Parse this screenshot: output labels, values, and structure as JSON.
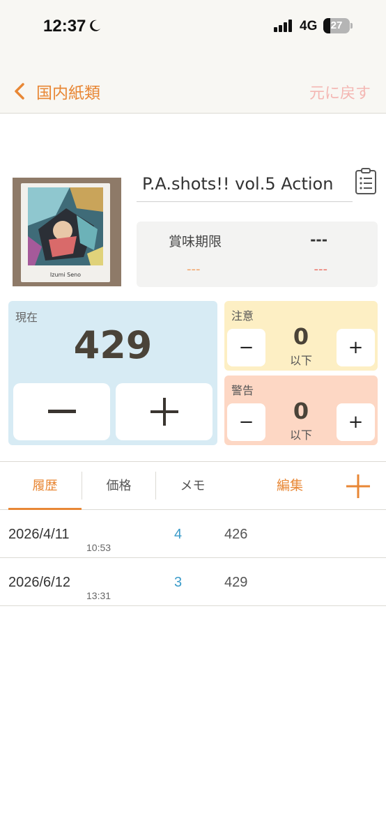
{
  "status_bar": {
    "time": "12:37",
    "network": "4G",
    "battery_percent": "27",
    "battery_level": 0.27
  },
  "nav": {
    "back_label": "国内紙類",
    "revert_label": "元に戻す"
  },
  "item": {
    "thumbnail_caption": "Izumi Seno",
    "title": "P.A.shots!! vol.5 Action"
  },
  "expiry": {
    "label": "賞味期限",
    "value": "---",
    "sub_left": "---",
    "sub_right": "---"
  },
  "stock": {
    "label": "現在",
    "value": "429"
  },
  "caution": {
    "label": "注意",
    "value": "0",
    "unit": "以下",
    "bg": "#fdefc4"
  },
  "warning": {
    "label": "警告",
    "value": "0",
    "unit": "以下",
    "bg": "#fdd7c4"
  },
  "tabs": {
    "history": "履歴",
    "price": "価格",
    "memo": "メモ",
    "edit": "編集"
  },
  "history": [
    {
      "date": "2026/4/11",
      "time": "10:53",
      "change": "4",
      "total": "426"
    },
    {
      "date": "2026/6/12",
      "time": "13:31",
      "change": "3",
      "total": "429"
    }
  ],
  "colors": {
    "accent": "#e88735",
    "stock_bg": "#d7ebf4",
    "change_blue": "#3b9bc9"
  }
}
